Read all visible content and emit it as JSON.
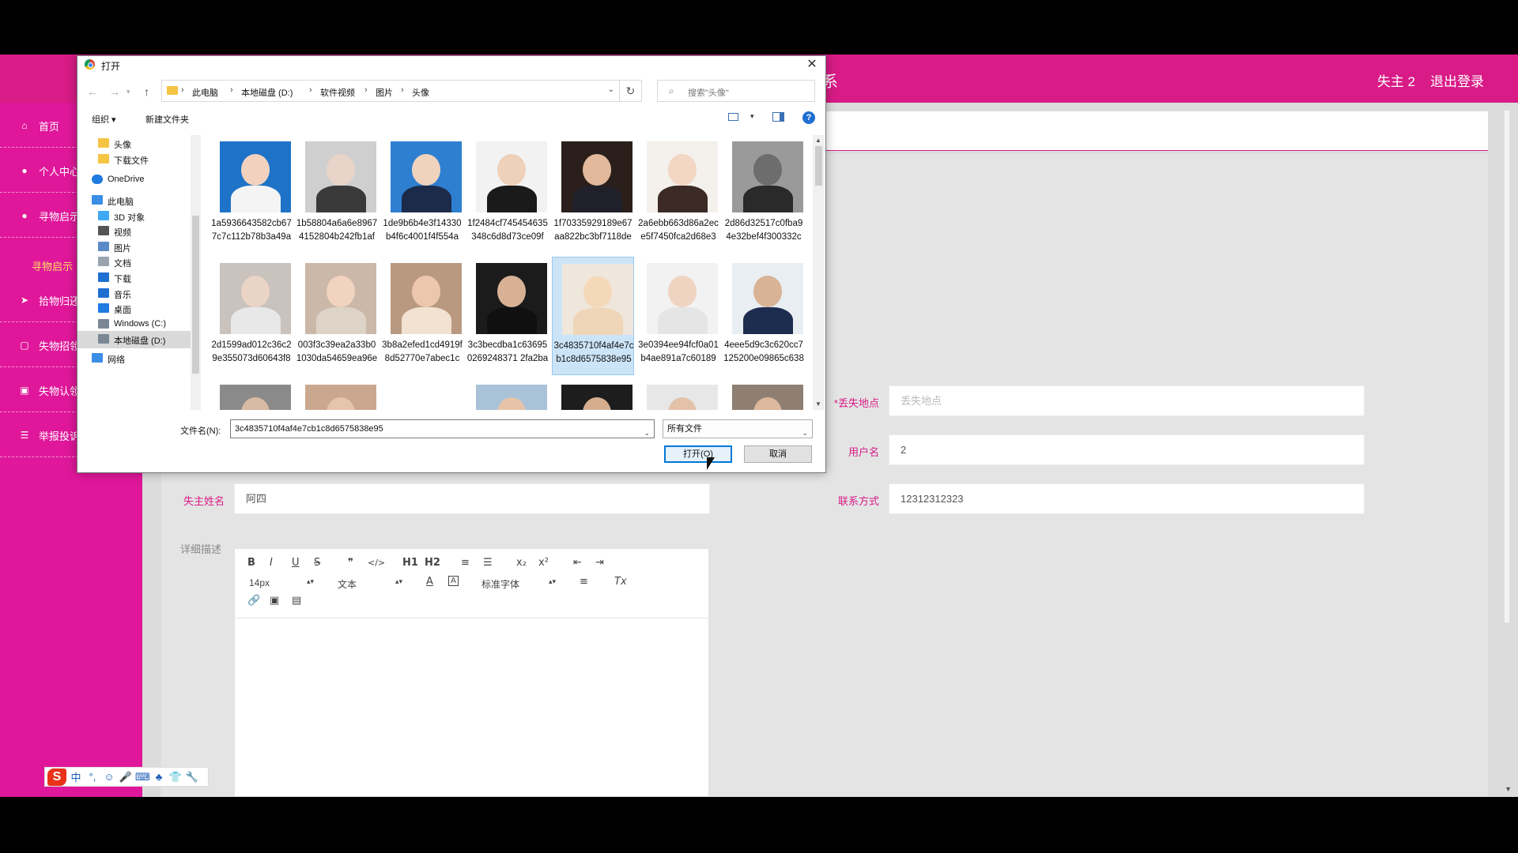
{
  "app": {
    "header_brand_tail": "系",
    "user": "失主 2",
    "logout": "退出登录"
  },
  "sidebar": {
    "items": [
      {
        "label": "首页",
        "icon": "home-icon"
      },
      {
        "label": "个人中心",
        "icon": "user-icon"
      },
      {
        "label": "寻物启示",
        "icon": "user-icon"
      },
      {
        "label": "拾物归还",
        "icon": "send-icon"
      },
      {
        "label": "失物招领",
        "icon": "square-icon"
      },
      {
        "label": "失物认领",
        "icon": "briefcase-icon"
      },
      {
        "label": "举报投诉",
        "icon": "list-icon"
      }
    ],
    "sub_item": "寻物启示"
  },
  "form": {
    "lost_place_label": "丢失地点",
    "lost_place_required": "*",
    "lost_place_placeholder": "丢失地点",
    "username_label": "用户名",
    "username_value": "2",
    "owner_name_label": "失主姓名",
    "owner_name_value": "阿四",
    "contact_label": "联系方式",
    "contact_value": "12312312323",
    "description_label": "详细描述"
  },
  "editor": {
    "font_size": "14px",
    "block_format": "文本",
    "font_family": "标准字体",
    "buttons": {
      "bold": "B",
      "italic": "I",
      "underline": "U",
      "strike": "S",
      "quote": "❞",
      "code": "</>",
      "h1": "H1",
      "h2": "H2",
      "ordered_list": "≡",
      "bullet_list": "☰",
      "subscript": "x₂",
      "superscript": "x²",
      "outdent": "⇤",
      "indent": "⇥",
      "font_color": "A",
      "bg_color": "A",
      "align": "≡",
      "clear_format": "Tx",
      "link": "🔗",
      "image": "▣",
      "video": "▤"
    }
  },
  "ime": {
    "logo": "S",
    "items": [
      "中",
      "°,",
      "☺",
      "🎤",
      "⌨",
      "♣",
      "👕",
      "🔧"
    ]
  },
  "dialog": {
    "title": "打开",
    "close": "✕",
    "breadcrumb": [
      "此电脑",
      "本地磁盘 (D:)",
      "软件视频",
      "图片",
      "头像"
    ],
    "search_placeholder": "搜索\"头像\"",
    "organize": "组织 ▾",
    "new_folder": "新建文件夹",
    "help": "?",
    "tree": [
      {
        "label": "头像",
        "icon": "folder-icon"
      },
      {
        "label": "下载文件",
        "icon": "folder-icon"
      },
      {
        "label": "OneDrive",
        "icon": "cloud-icon"
      },
      {
        "label": "此电脑",
        "icon": "computer-icon"
      },
      {
        "label": "3D 对象",
        "icon": "cube-icon"
      },
      {
        "label": "视频",
        "icon": "video-icon"
      },
      {
        "label": "图片",
        "icon": "picture-icon"
      },
      {
        "label": "文档",
        "icon": "document-icon"
      },
      {
        "label": "下载",
        "icon": "download-icon"
      },
      {
        "label": "音乐",
        "icon": "music-icon"
      },
      {
        "label": "桌面",
        "icon": "desktop-icon"
      },
      {
        "label": "Windows (C:)",
        "icon": "drive-icon"
      },
      {
        "label": "本地磁盘 (D:)",
        "icon": "drive-icon"
      },
      {
        "label": "网络",
        "icon": "network-icon"
      }
    ],
    "files": [
      {
        "name": "1a5936643582cb677c7c112b78b3a49a",
        "bg": "#1e73c8",
        "skin": "#f2d2be",
        "cloth": "#f4f4f4"
      },
      {
        "name": "1b58804a6a6e89674152804b242fb1af",
        "bg": "#cfcfcf",
        "skin": "#e8d4c8",
        "cloth": "#3a3a3a"
      },
      {
        "name": "1de9b6b4e3f14330b4f6c4001f4f554a",
        "bg": "#2f7fd0",
        "skin": "#f0d3bd",
        "cloth": "#1c2b4a"
      },
      {
        "name": "1f2484cf745454635348c6d8d73ce09f",
        "bg": "#f2f2f2",
        "skin": "#efd0b8",
        "cloth": "#1a1a1a"
      },
      {
        "name": "1f70335929189e67aa822bc3bf7118de",
        "bg": "#2a1f1a",
        "skin": "#e2b99d",
        "cloth": "#20202a"
      },
      {
        "name": "2a6ebb663d86a2ece5f7450fca2d68e3",
        "bg": "#f4f0ec",
        "skin": "#f3d6c3",
        "cloth": "#3b2a25"
      },
      {
        "name": "2d86d32517c0fba94e32bef4f300332c",
        "bg": "#9a9a9a",
        "skin": "#6d6d6d",
        "cloth": "#2a2a2a"
      },
      {
        "name": "2d1599ad012c36c29e355073d60643f8",
        "bg": "#c9c2bd",
        "skin": "#ead4c6",
        "cloth": "#e8e8e8"
      },
      {
        "name": "003f3c39ea2a33b01030da54659ea96e",
        "bg": "#cbb8a8",
        "skin": "#f1d3c0",
        "cloth": "#ded3c7"
      },
      {
        "name": "3b8a2efed1cd4919f8d52770e7abec1c",
        "bg": "#b99a80",
        "skin": "#ecc7ae",
        "cloth": "#f1e2d2"
      },
      {
        "name": "3c3becdba1c636950269248371 2fa2ba",
        "bg": "#1b1b1b",
        "skin": "#d8b195",
        "cloth": "#101010"
      },
      {
        "name": "3c4835710f4af4e7cb1c8d6575838e95",
        "bg": "#efe6dc",
        "skin": "#f5d8b8",
        "cloth": "#efd6b8"
      },
      {
        "name": "3e0394ee94fcf0a01b4ae891a7c60189",
        "bg": "#f2f2f2",
        "skin": "#f0d4c2",
        "cloth": "#e5e5e5"
      },
      {
        "name": "4eee5d9c3c620cc7125200e09865c638",
        "bg": "#e9eef2",
        "skin": "#d9b396",
        "cloth": "#1d2d50"
      },
      {
        "name": "",
        "bg": "#8a8a8a",
        "skin": "#d8b9a2",
        "cloth": "#333"
      },
      {
        "name": "",
        "bg": "#caa88f",
        "skin": "#e6c5ad",
        "cloth": "#2a1d17"
      },
      {
        "name": "",
        "bg": "#ffffff",
        "skin": "#ffffff",
        "cloth": "#222"
      },
      {
        "name": "",
        "bg": "#a9c2d8",
        "skin": "#e5c4a9",
        "cloth": "#5b7590"
      },
      {
        "name": "",
        "bg": "#1d1d1d",
        "skin": "#d6ae8f",
        "cloth": "#2a2a2a"
      },
      {
        "name": "",
        "bg": "#e7e7e7",
        "skin": "#e3c2a9",
        "cloth": "#444"
      },
      {
        "name": "",
        "bg": "#8f7f72",
        "skin": "#dcb89c",
        "cloth": "#2f2f2f"
      }
    ],
    "filename_label": "文件名(N):",
    "filename_value": "3c4835710f4af4e7cb1c8d6575838e95",
    "filter": "所有文件",
    "open": "打开(O)",
    "cancel": "取消"
  }
}
